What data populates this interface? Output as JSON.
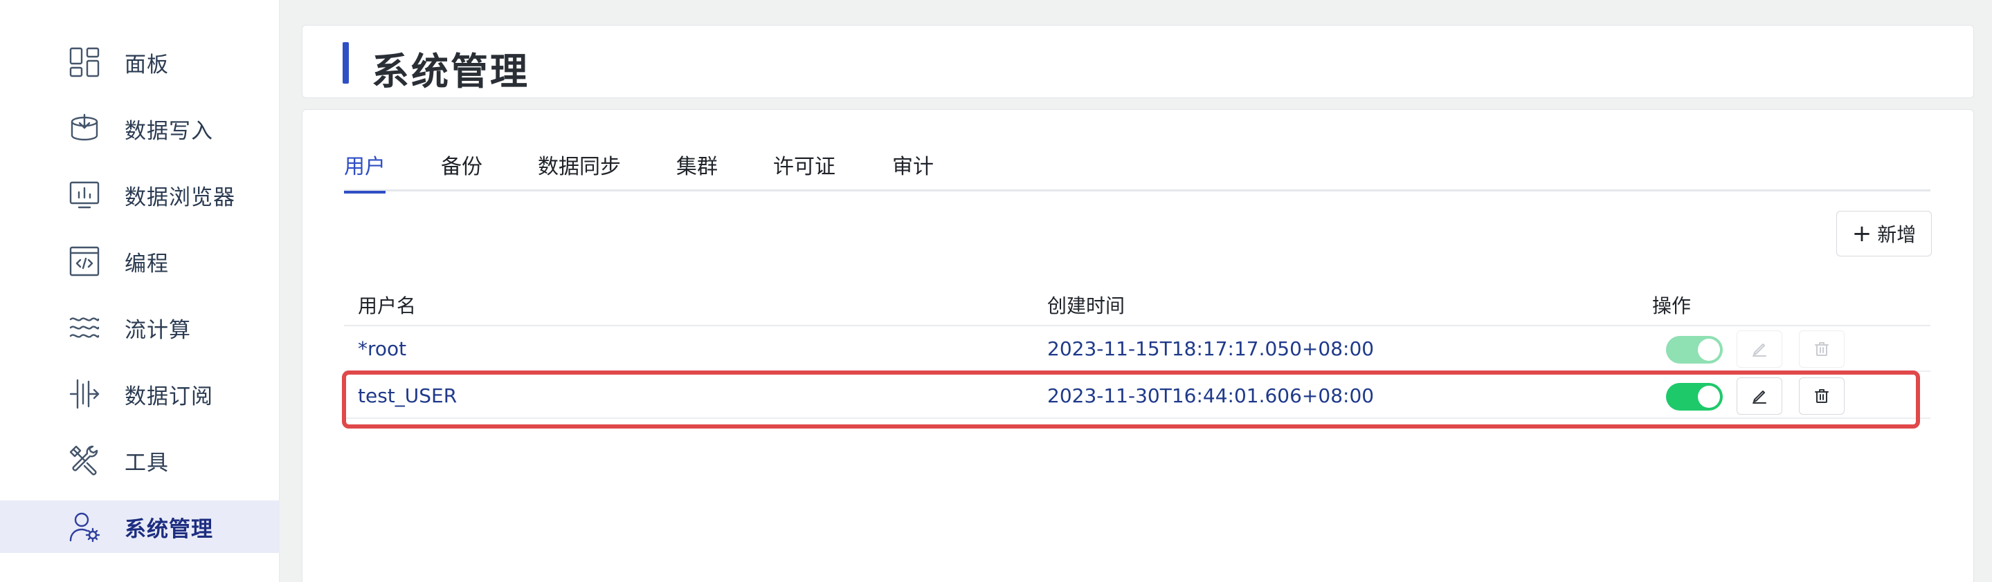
{
  "sidebar": {
    "items": [
      {
        "label": "面板",
        "icon": "dashboard-icon"
      },
      {
        "label": "数据写入",
        "icon": "data-import-icon"
      },
      {
        "label": "数据浏览器",
        "icon": "data-browser-icon"
      },
      {
        "label": "编程",
        "icon": "code-window-icon"
      },
      {
        "label": "流计算",
        "icon": "stream-waves-icon"
      },
      {
        "label": "数据订阅",
        "icon": "subscription-icon"
      },
      {
        "label": "工具",
        "icon": "tools-icon"
      },
      {
        "label": "系统管理",
        "icon": "user-settings-icon",
        "active": true
      }
    ]
  },
  "header": {
    "title": "系统管理"
  },
  "tabs": [
    {
      "label": "用户",
      "active": true
    },
    {
      "label": "备份"
    },
    {
      "label": "数据同步"
    },
    {
      "label": "集群"
    },
    {
      "label": "许可证"
    },
    {
      "label": "审计"
    }
  ],
  "toolbar": {
    "add_label": "新增",
    "add_icon": "+"
  },
  "table": {
    "columns": [
      "用户名",
      "创建时间",
      "操作"
    ],
    "rows": [
      {
        "username": "*root",
        "created": "2023-11-15T18:17:17.050+08:00",
        "enabled": true,
        "actions_disabled": true
      },
      {
        "username": "test_USER",
        "created": "2023-11-30T16:44:01.606+08:00",
        "enabled": true,
        "actions_disabled": false,
        "highlighted": true
      }
    ]
  },
  "colors": {
    "accent": "#2f4fc4",
    "toggle_on": "#1ec96a",
    "highlight": "#e0484a"
  }
}
